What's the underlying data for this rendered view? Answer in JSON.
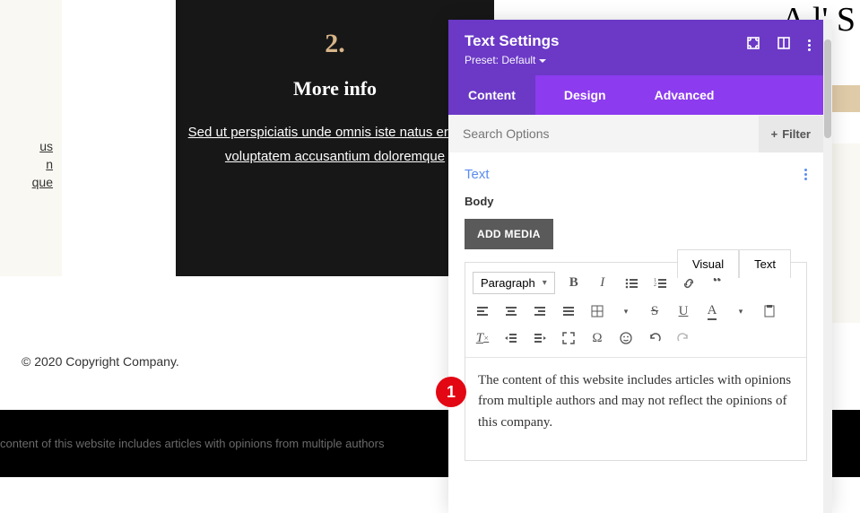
{
  "bg_left": {
    "line1": "us",
    "line2": "n",
    "line3": "que"
  },
  "dark_card": {
    "num": "2.",
    "title": "More info",
    "body": "Sed ut perspiciatis unde omnis iste natus error sit voluptatem accusantium doloremque"
  },
  "top_right": "A          l'   S",
  "copyright": "© 2020 Copyright Company.",
  "footer_text": "content of this website includes articles with opinions from multiple authors",
  "marker": "1",
  "panel": {
    "title": "Text Settings",
    "preset_label": "Preset: Default",
    "tabs": {
      "content": "Content",
      "design": "Design",
      "advanced": "Advanced"
    },
    "search_placeholder": "Search Options",
    "filter_label": "Filter",
    "section_title": "Text",
    "body_label": "Body",
    "add_media": "ADD MEDIA",
    "editor_tabs": {
      "visual": "Visual",
      "text": "Text"
    },
    "format_select": "Paragraph",
    "editor_body": "The content of this website includes articles with opinions from multiple authors and may not reflect the opinions of this company."
  }
}
